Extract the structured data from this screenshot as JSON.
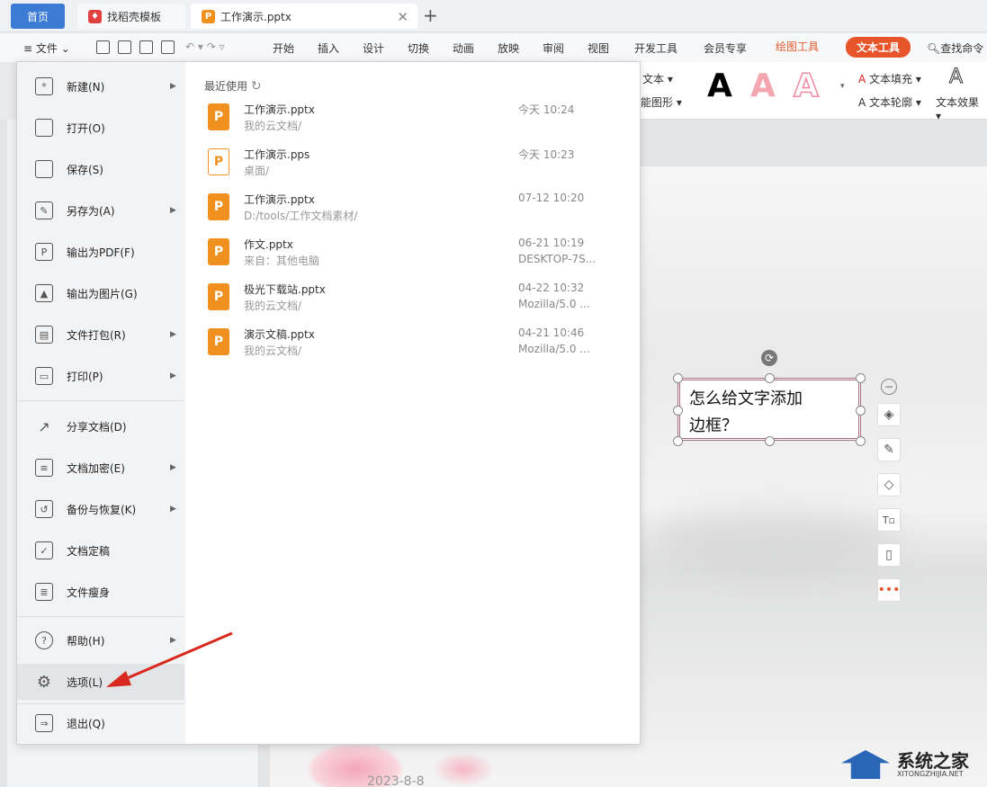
{
  "tabs": {
    "home": "首页",
    "template": "找稻壳模板",
    "doc": "工作演示.pptx"
  },
  "menubar": {
    "file": "文件",
    "items": [
      "开始",
      "插入",
      "设计",
      "切换",
      "动画",
      "放映",
      "审阅",
      "视图",
      "开发工具",
      "会员专享"
    ],
    "draw_tools": "绘图工具",
    "text_tools": "文本工具",
    "search": "查找命令"
  },
  "ribbon": {
    "text_box": "文本",
    "smart_shape": "能图形",
    "fill": "文本填充",
    "outline": "文本轮廓",
    "effect": "文本效果",
    "letter": "A"
  },
  "file_menu": [
    {
      "label": "新建(N)",
      "icon": "new-icon",
      "arrow": true
    },
    {
      "label": "打开(O)",
      "icon": "folder-icon",
      "arrow": false
    },
    {
      "label": "保存(S)",
      "icon": "save-icon",
      "arrow": false
    },
    {
      "label": "另存为(A)",
      "icon": "save-as-icon",
      "arrow": true
    },
    {
      "label": "输出为PDF(F)",
      "icon": "pdf-icon",
      "arrow": false
    },
    {
      "label": "输出为图片(G)",
      "icon": "image-icon",
      "arrow": false
    },
    {
      "label": "文件打包(R)",
      "icon": "package-icon",
      "arrow": true
    },
    {
      "label": "打印(P)",
      "icon": "print-icon",
      "arrow": true
    },
    {
      "label": "分享文档(D)",
      "icon": "share-icon",
      "arrow": false
    },
    {
      "label": "文档加密(E)",
      "icon": "encrypt-icon",
      "arrow": true
    },
    {
      "label": "备份与恢复(K)",
      "icon": "backup-icon",
      "arrow": true
    },
    {
      "label": "文档定稿",
      "icon": "finalize-icon",
      "arrow": false
    },
    {
      "label": "文件瘦身",
      "icon": "slim-icon",
      "arrow": false
    },
    {
      "label": "帮助(H)",
      "icon": "help-icon",
      "arrow": true
    },
    {
      "label": "选项(L)",
      "icon": "gear-icon",
      "arrow": false
    },
    {
      "label": "退出(Q)",
      "icon": "exit-icon",
      "arrow": false
    }
  ],
  "recent": {
    "heading": "最近使用",
    "files": [
      {
        "name": "工作演示.pptx",
        "path": "我的云文档/",
        "time": "今天  10:24",
        "source": "",
        "kind": "pptx"
      },
      {
        "name": "工作演示.pps",
        "path": "桌面/",
        "time": "今天  10:23",
        "source": "",
        "kind": "pps"
      },
      {
        "name": "工作演示.pptx",
        "path": "D:/tools/工作文档素材/",
        "time": "07-12 10:20",
        "source": "",
        "kind": "pptx"
      },
      {
        "name": "作文.pptx",
        "path": "来自：其他电脑",
        "time": "06-21 10:19",
        "source": "DESKTOP-7S...",
        "kind": "pptx"
      },
      {
        "name": "极光下载站.pptx",
        "path": "我的云文档/",
        "time": "04-22 10:32",
        "source": "Mozilla/5.0 ...",
        "kind": "pptx"
      },
      {
        "name": "演示文稿.pptx",
        "path": "我的云文档/",
        "time": "04-21 10:46",
        "source": "Mozilla/5.0 ...",
        "kind": "pptx"
      }
    ]
  },
  "slide": {
    "text_line1": "怎么给文字添加",
    "text_line2": "边框？",
    "date": "2023-8-8"
  },
  "watermark": {
    "title": "系统之家",
    "url": "XITONGZHIJIA.NET"
  },
  "colors": {
    "accent": "#e8542a",
    "ppt_orange": "#f0901e",
    "home_blue": "#3b7bd4"
  }
}
